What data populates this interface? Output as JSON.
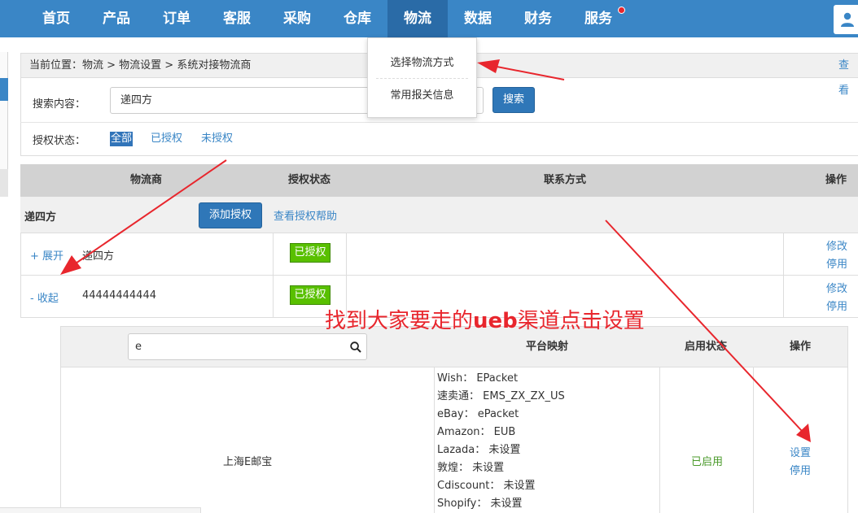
{
  "nav": {
    "items": [
      "首页",
      "产品",
      "订单",
      "客服",
      "采购",
      "仓库",
      "物流",
      "数据",
      "财务",
      "服务"
    ],
    "active_index": 6,
    "notification_dot_color": "#e8262d",
    "bar_color": "#3a86c6"
  },
  "breadcrumb": {
    "text": "当前位置：物流 > 物流设置 > 系统对接物流商",
    "right_link": "查看"
  },
  "dropdown": {
    "items": [
      "选择物流方式",
      "常用报关信息"
    ]
  },
  "search": {
    "label": "搜索内容：",
    "value": "递四方",
    "button": "搜索",
    "auth_label": "授权状态：",
    "filters": [
      "全部",
      "已授权",
      "未授权"
    ]
  },
  "table": {
    "headers": [
      "物流商",
      "授权状态",
      "联系方式",
      "操作"
    ],
    "group": {
      "name": "递四方",
      "add_button": "添加授权",
      "help_link": "查看授权帮助"
    },
    "rows": [
      {
        "toggle": "+ 展开",
        "account": "递四方",
        "status": "已授权",
        "actions": [
          "修改",
          "停用"
        ]
      },
      {
        "toggle": "- 收起",
        "account": "44444444444",
        "status": "已授权",
        "actions": [
          "修改",
          "停用"
        ]
      }
    ]
  },
  "annotation": {
    "before": "找到大家要走的",
    "bold": "ueb",
    "after": "渠道点击设置",
    "color": "#e8262d"
  },
  "subtable": {
    "search_value": "e",
    "headers": [
      "平台映射",
      "启用状态",
      "操作"
    ],
    "row": {
      "name": "上海E邮宝",
      "mappings": [
        "Wish： EPacket",
        "速卖通： EMS_ZX_ZX_US",
        "eBay： ePacket",
        "Amazon： EUB",
        "Lazada： 未设置",
        "敦煌： 未设置",
        "Cdiscount： 未设置",
        "Shopify： 未设置"
      ],
      "status": "已启用",
      "actions": [
        "设置",
        "停用"
      ]
    }
  }
}
